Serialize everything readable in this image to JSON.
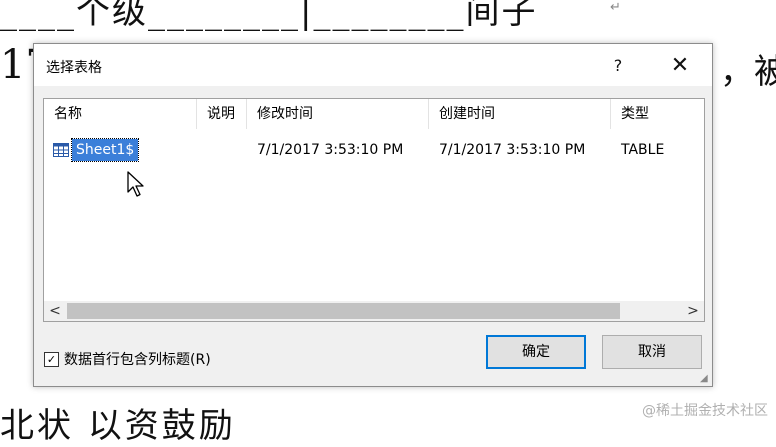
{
  "background": {
    "top_line": "____个级________|________间子",
    "return_mark": "↵",
    "left_fragment": "17",
    "right_fragment": "，被",
    "bottom_line": "北状  以资鼓励"
  },
  "watermark": "@稀土掘金技术社区",
  "dialog": {
    "title": "选择表格",
    "help_label": "?",
    "close_label": "✕",
    "columns": [
      "名称",
      "说明",
      "修改时间",
      "创建时间",
      "类型"
    ],
    "rows": [
      {
        "name": "Sheet1$",
        "description": "",
        "modified": "7/1/2017 3:53:10 PM",
        "created": "7/1/2017 3:53:10 PM",
        "type": "TABLE"
      }
    ],
    "scroll_left": "<",
    "scroll_right": ">",
    "checkbox": {
      "label": "数据首行包含列标题(R)",
      "checked": true,
      "mark": "✓"
    },
    "ok_label": "确定",
    "cancel_label": "取消",
    "colors": {
      "selection": "#3b7fd9",
      "default_button_border": "#0078d7"
    }
  }
}
